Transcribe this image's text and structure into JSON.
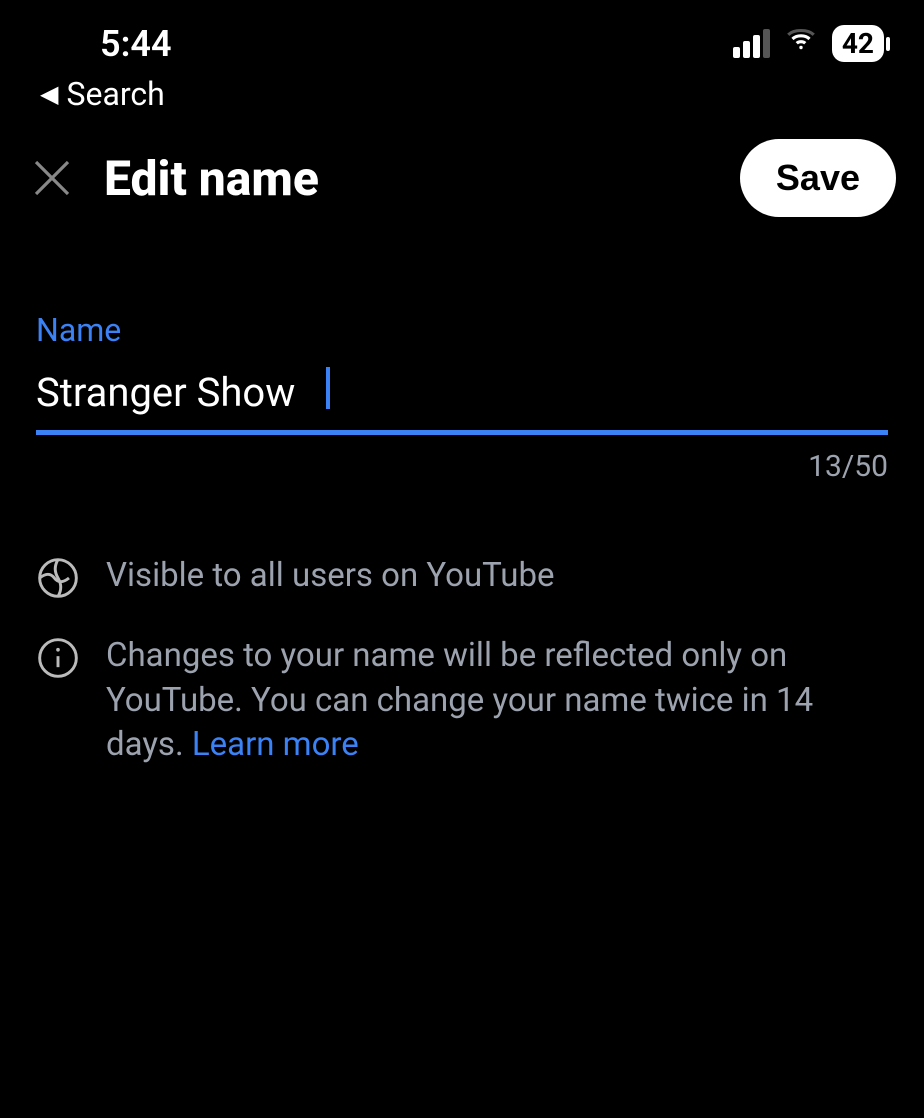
{
  "statusBar": {
    "time": "5:44",
    "battery": "42"
  },
  "back": {
    "label": "Search"
  },
  "header": {
    "title": "Edit name",
    "saveLabel": "Save"
  },
  "form": {
    "fieldLabel": "Name",
    "value": "Stranger Show",
    "counter": "13/50"
  },
  "info": {
    "visibility": "Visible to all users on YouTube",
    "changes": "Changes to your name will be reflected only on YouTube. You can change your name twice in 14 days.",
    "learnMore": "Learn more"
  }
}
